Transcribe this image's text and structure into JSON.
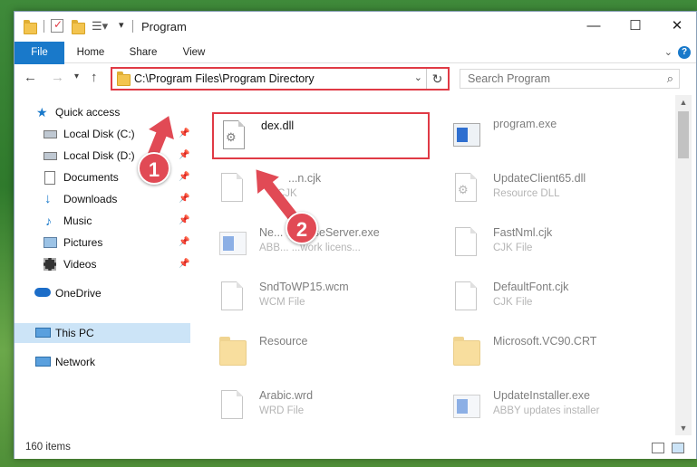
{
  "window": {
    "title": "Program"
  },
  "ribbon": {
    "tabs": [
      "File",
      "Home",
      "Share",
      "View"
    ]
  },
  "address": {
    "path": "C:\\Program Files\\Program Directory"
  },
  "search": {
    "placeholder": "Search Program"
  },
  "nav": {
    "quick_access": "Quick access",
    "items": [
      {
        "label": "Local Disk (C:)",
        "icon": "drive-icon"
      },
      {
        "label": "Local Disk (D:)",
        "icon": "drive-icon"
      },
      {
        "label": "Documents",
        "icon": "documents-icon"
      },
      {
        "label": "Downloads",
        "icon": "downloads-icon"
      },
      {
        "label": "Music",
        "icon": "music-icon"
      },
      {
        "label": "Pictures",
        "icon": "pictures-icon"
      },
      {
        "label": "Videos",
        "icon": "videos-icon"
      }
    ],
    "onedrive": "OneDrive",
    "this_pc": "This PC",
    "network": "Network"
  },
  "files": [
    {
      "name": "dex.dll",
      "type": "",
      "icon": "dll-icon"
    },
    {
      "name": "program.exe",
      "type": "",
      "icon": "exe-icon"
    },
    {
      "name": "...n.cjk",
      "type": "CJK",
      "icon": "file-icon"
    },
    {
      "name": "UpdateClient65.dll",
      "type": "Resource DLL",
      "icon": "dll-icon"
    },
    {
      "name": "Ne... LicenseServer.exe",
      "type": "ABB... ...work licens...",
      "icon": "exe-icon"
    },
    {
      "name": "FastNml.cjk",
      "type": "CJK File",
      "icon": "file-icon"
    },
    {
      "name": "SndToWP15.wcm",
      "type": "WCM File",
      "icon": "file-icon"
    },
    {
      "name": "DefaultFont.cjk",
      "type": "CJK File",
      "icon": "file-icon"
    },
    {
      "name": "Resource",
      "type": "",
      "icon": "folder-icon"
    },
    {
      "name": "Microsoft.VC90.CRT",
      "type": "",
      "icon": "folder-icon"
    },
    {
      "name": "Arabic.wrd",
      "type": "WRD File",
      "icon": "file-icon"
    },
    {
      "name": "UpdateInstaller.exe",
      "type": "ABBY updates installer",
      "icon": "exe-icon"
    }
  ],
  "status": {
    "items": "160 items"
  },
  "annotations": {
    "step1": "1",
    "step2": "2"
  },
  "colors": {
    "accent": "#1979ca",
    "highlight": "#e03a45",
    "selected": "#cce4f7"
  }
}
